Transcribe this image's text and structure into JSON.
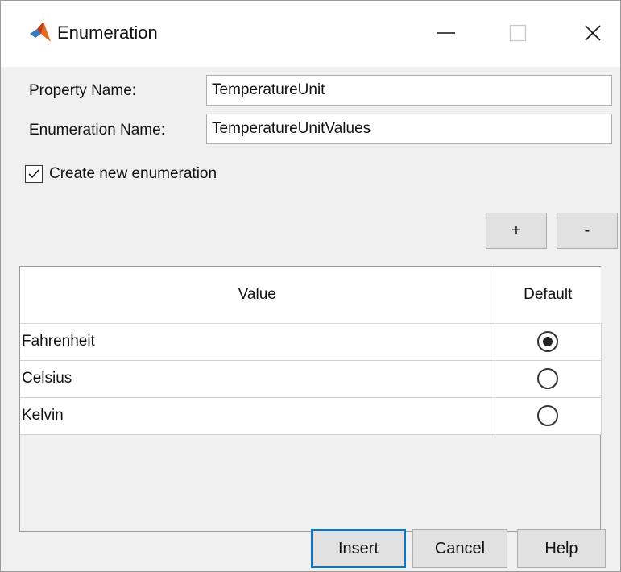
{
  "window": {
    "title": "Enumeration",
    "app_icon": "matlab-logo-icon",
    "controls": [
      "minimize-icon",
      "maximize-icon",
      "close-icon"
    ]
  },
  "form": {
    "property_name_label": "Property Name:",
    "property_name_value": "TemperatureUnit",
    "enumeration_name_label": "Enumeration Name:",
    "enumeration_name_value": "TemperatureUnitValues",
    "create_new_label": "Create new enumeration",
    "create_new_checked": true
  },
  "table_controls": {
    "add_label": "+",
    "remove_label": "-"
  },
  "table": {
    "columns": [
      "Value",
      "Default"
    ],
    "rows": [
      {
        "value": "Fahrenheit",
        "default": true
      },
      {
        "value": "Celsius",
        "default": false
      },
      {
        "value": "Kelvin",
        "default": false
      }
    ]
  },
  "actions": {
    "insert_label": "Insert",
    "cancel_label": "Cancel",
    "help_label": "Help"
  },
  "colors": {
    "focus_accent": "#0078d7",
    "dialog_background": "#f0f0f0",
    "button_face": "#e1e1e1"
  }
}
